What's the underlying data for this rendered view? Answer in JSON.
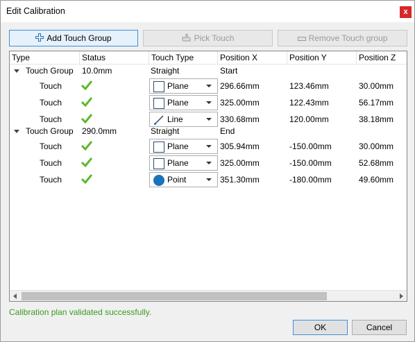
{
  "window": {
    "title": "Edit Calibration",
    "close_glyph": "x"
  },
  "toolbar": {
    "add_label": "Add Touch Group",
    "pick_label": "Pick Touch",
    "remove_label": "Remove Touch group"
  },
  "columns": [
    "Type",
    "Status",
    "Touch Type",
    "Position X",
    "Position Y",
    "Position Z"
  ],
  "groups": [
    {
      "type": "Touch Group",
      "status": "10.0mm",
      "touch_type": "Straight",
      "pos_x": "Start",
      "touches": [
        {
          "type": "Touch",
          "touch_type": "Plane",
          "icon": "plane-icon",
          "x": "296.66mm",
          "y": "123.46mm",
          "z": "30.00mm"
        },
        {
          "type": "Touch",
          "touch_type": "Plane",
          "icon": "plane-icon",
          "x": "325.00mm",
          "y": "122.43mm",
          "z": "56.17mm"
        },
        {
          "type": "Touch",
          "touch_type": "Line",
          "icon": "line-icon",
          "x": "330.68mm",
          "y": "120.00mm",
          "z": "38.18mm"
        }
      ]
    },
    {
      "type": "Touch Group",
      "status": "290.0mm",
      "touch_type": "Straight",
      "pos_x": "End",
      "touches": [
        {
          "type": "Touch",
          "touch_type": "Plane",
          "icon": "plane-icon",
          "x": "305.94mm",
          "y": "-150.00mm",
          "z": "30.00mm"
        },
        {
          "type": "Touch",
          "touch_type": "Plane",
          "icon": "plane-icon",
          "x": "325.00mm",
          "y": "-150.00mm",
          "z": "52.68mm"
        },
        {
          "type": "Touch",
          "touch_type": "Point",
          "icon": "point-icon",
          "x": "351.30mm",
          "y": "-180.00mm",
          "z": "49.60mm"
        }
      ]
    }
  ],
  "status_message": "Calibration plan validated successfully.",
  "buttons": {
    "ok": "OK",
    "cancel": "Cancel"
  },
  "colors": {
    "accent": "#3c8fdc",
    "success": "#3a9a1c",
    "check": "#5cb82e",
    "point": "#1a72b8"
  }
}
